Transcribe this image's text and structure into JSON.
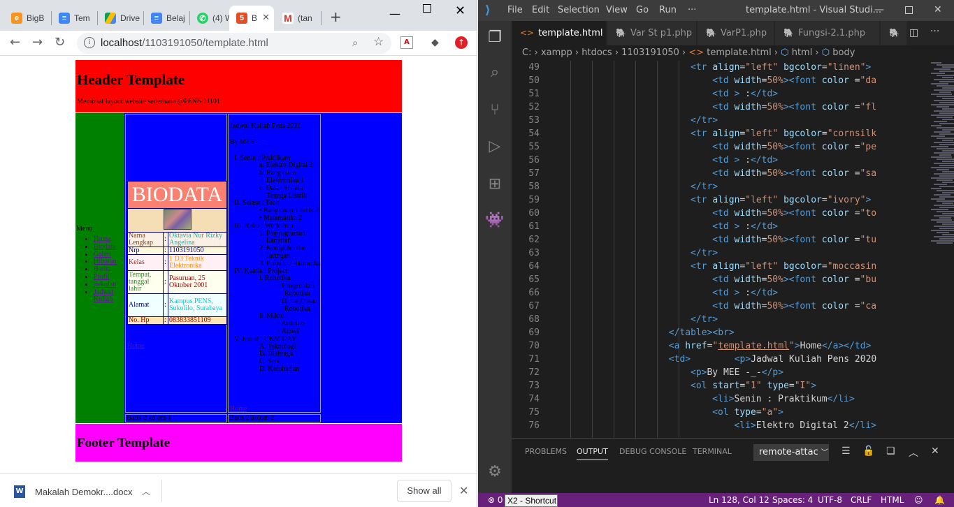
{
  "browser": {
    "tabs": [
      {
        "label": "BigB",
        "icon": "e"
      },
      {
        "label": "Tem",
        "icon": "doc"
      },
      {
        "label": "Drive",
        "icon": "drive"
      },
      {
        "label": "Belaj",
        "icon": "doc"
      },
      {
        "label": "(4) W",
        "icon": "whatsapp"
      },
      {
        "label": "B",
        "icon": "html5"
      },
      {
        "label": "(tan",
        "icon": "gmail"
      }
    ],
    "new_tab": "+",
    "url_host": "localhost",
    "url_path": "/1103191050/template.html",
    "download": {
      "filename": "Makalah Demokr....docx",
      "show_all": "Show all"
    }
  },
  "site": {
    "header_title": "Header Template",
    "header_subtitle": "Membuat layout website sederhana @PENS-1J101",
    "menu_title": "Menu",
    "menu_items": [
      "Home",
      "Biodata",
      "Galeri",
      "Hiburan",
      "Berita",
      "Profil",
      "Sekolah",
      "Jadwal Kuliah"
    ],
    "biodata": {
      "title": "BIODATA",
      "rows": [
        {
          "label": "Nama Lengkap",
          "sep": ":",
          "value": "Oktavia Nur Rizky Angelina",
          "bg": "#faf0e6",
          "lcolor": "#8b4513",
          "vcolor": "#20b2aa"
        },
        {
          "label": "Nrp",
          "sep": ":",
          "value": "1103191050",
          "bg": "#fff8dc",
          "lcolor": "#000080",
          "vcolor": "#000080"
        },
        {
          "label": "Kelas",
          "sep": ":",
          "value": "1 D3 Teknik Elektronika",
          "bg": "#fff0f5",
          "lcolor": "#b22222",
          "vcolor": "#ff8c00"
        },
        {
          "label": "Tempat, tanggal lahir",
          "sep": ":",
          "value": "Pasuruan, 25 Oktober 2001",
          "bg": "#fffff0",
          "lcolor": "#228b22",
          "vcolor": "#8b0000"
        },
        {
          "label": "Alamat",
          "sep": ":",
          "value": "Kampus PENS, Sukolilo, Surabaya",
          "bg": "#f0ffff",
          "lcolor": "#000080",
          "vcolor": "#00ced1"
        },
        {
          "label": "No. Hp",
          "sep": ":",
          "value": "083833851109",
          "bg": "#ffe4b5",
          "lcolor": "#8b0000",
          "vcolor": "#8b0000"
        }
      ],
      "home_link": "Home"
    },
    "schedule": {
      "title": "Jadwal Kuliah Pens 2020",
      "by": "By MEE -_-",
      "days": [
        {
          "num": "I.",
          "label": "Senin : Praktikum",
          "style": "a",
          "items": [
            {
              "m": "a.",
              "t": "Elektro Digital 2"
            },
            {
              "m": "b.",
              "t": "Rangkaian Elektronika 1"
            },
            {
              "m": "c.",
              "t": "Dasar Sistem Tenaga Listrik"
            }
          ]
        },
        {
          "num": "II.",
          "label": "Selasa : Teori",
          "style": "disc",
          "items": [
            {
              "m": "•",
              "t": "Rangkaian Listrik 2"
            },
            {
              "m": "•",
              "t": "Matematika 2"
            }
          ]
        },
        {
          "num": "III.",
          "label": "Rabu : Workshop",
          "style": "1",
          "items": [
            {
              "m": "1.",
              "t": "Pemrograman Lanjutan"
            },
            {
              "m": "2.",
              "t": "Komputer dan Jaringan"
            },
            {
              "m": "3.",
              "t": "Proyek Elektronika"
            }
          ]
        },
        {
          "num": "IV.",
          "label": "Kamis : Project",
          "style": "i",
          "items": [
            {
              "m": "i.",
              "t": "Robotika",
              "sub": [
                "Pengenalan Robotika",
                "Dasar-Dasar Robotika"
              ]
            },
            {
              "m": "ii.",
              "t": "Mikro",
              "sub": [
                "Arduino",
                "Atmel"
              ]
            }
          ]
        },
        {
          "num": "V.",
          "label": "Jumat : UKM DAY",
          "style": "A",
          "items": [
            {
              "m": "A.",
              "t": "Teknologi"
            },
            {
              "m": "B.",
              "t": "Olahraga"
            },
            {
              "m": "C.",
              "t": "Seni"
            },
            {
              "m": "D.",
              "t": "Keroharian"
            }
          ]
        }
      ],
      "home_link": "Home"
    },
    "row2_col1": "Baris 2 kolom 1",
    "row2_col2": "Baris 2 kolom 2",
    "footer_title": "Footer Template"
  },
  "vscode": {
    "menu": [
      "File",
      "Edit",
      "Selection",
      "View",
      "Go",
      "Run",
      "···"
    ],
    "window_title": "template.html - Visual Studi...",
    "tabs": [
      {
        "label": "template.html",
        "type": "html",
        "active": true
      },
      {
        "label": "Var St p1.php",
        "type": "php",
        "active": false
      },
      {
        "label": "VarP1.php",
        "type": "php",
        "active": false
      },
      {
        "label": "Fungsi-2.1.php",
        "type": "php",
        "active": false
      }
    ],
    "breadcrumb": [
      "C:",
      "xampp",
      "htdocs",
      "1103191050",
      "template.html",
      "html",
      "body"
    ],
    "code_lines": [
      {
        "n": "49",
        "i": 8,
        "h": "<span class=\"t\">&lt;tr</span> <span class=\"a\">align</span>=<span class=\"s\">\"left\"</span> <span class=\"a\">bgcolor</span>=<span class=\"s\">\"linen\"</span><span class=\"t\">&gt;</span>"
      },
      {
        "n": "50",
        "i": 12,
        "h": "<span class=\"t\">&lt;td</span> <span class=\"a\">width</span>=<span class=\"s\">50%</span><span class=\"t\">&gt;&lt;font</span> <span class=\"a\">color</span> =<span class=\"s\">\"da</span>"
      },
      {
        "n": "51",
        "i": 12,
        "h": "<span class=\"t\">&lt;td</span> <span class=\"t\">&gt;</span> :<span class=\"t\">&lt;/td&gt;</span>"
      },
      {
        "n": "52",
        "i": 12,
        "h": "<span class=\"t\">&lt;td</span> <span class=\"a\">width</span>=<span class=\"s\">50%</span><span class=\"t\">&gt;&lt;font</span> <span class=\"a\">color</span> =<span class=\"s\">\"fl</span>"
      },
      {
        "n": "53",
        "i": 8,
        "h": "<span class=\"t\">&lt;/tr&gt;</span>"
      },
      {
        "n": "54",
        "i": 8,
        "h": "<span class=\"t\">&lt;tr</span> <span class=\"a\">align</span>=<span class=\"s\">\"left\"</span> <span class=\"a\">bgcolor</span>=<span class=\"s\">\"cornsilk</span>"
      },
      {
        "n": "55",
        "i": 12,
        "h": "<span class=\"t\">&lt;td</span> <span class=\"a\">width</span>=<span class=\"s\">50%</span><span class=\"t\">&gt;&lt;font</span> <span class=\"a\">color</span> =<span class=\"s\">\"pe</span>"
      },
      {
        "n": "56",
        "i": 12,
        "h": "<span class=\"t\">&lt;td</span> <span class=\"t\">&gt;</span> :<span class=\"t\">&lt;/td&gt;</span>"
      },
      {
        "n": "57",
        "i": 12,
        "h": "<span class=\"t\">&lt;td</span> <span class=\"a\">width</span>=<span class=\"s\">50%</span><span class=\"t\">&gt;&lt;font</span> <span class=\"a\">color</span> =<span class=\"s\">\"sa</span>"
      },
      {
        "n": "58",
        "i": 8,
        "h": "<span class=\"t\">&lt;/tr&gt;</span>"
      },
      {
        "n": "59",
        "i": 8,
        "h": "<span class=\"t\">&lt;tr</span> <span class=\"a\">align</span>=<span class=\"s\">\"left\"</span> <span class=\"a\">bgcolor</span>=<span class=\"s\">\"ivory\"</span><span class=\"t\">&gt;</span>"
      },
      {
        "n": "60",
        "i": 12,
        "h": "<span class=\"t\">&lt;td</span> <span class=\"a\">width</span>=<span class=\"s\">50%</span><span class=\"t\">&gt;&lt;font</span> <span class=\"a\">color</span> =<span class=\"s\">\"to</span>"
      },
      {
        "n": "61",
        "i": 12,
        "h": "<span class=\"t\">&lt;td</span> <span class=\"t\">&gt;</span> :<span class=\"t\">&lt;/td&gt;</span>"
      },
      {
        "n": "62",
        "i": 12,
        "h": "<span class=\"t\">&lt;td</span> <span class=\"a\">width</span>=<span class=\"s\">50%</span><span class=\"t\">&gt;&lt;font</span> <span class=\"a\">color</span> =<span class=\"s\">\"tu</span>"
      },
      {
        "n": "63",
        "i": 8,
        "h": "<span class=\"t\">&lt;/tr&gt;</span>"
      },
      {
        "n": "64",
        "i": 8,
        "h": "<span class=\"t\">&lt;tr</span> <span class=\"a\">align</span>=<span class=\"s\">\"left\"</span> <span class=\"a\">bgcolor</span>=<span class=\"s\">\"moccasin</span>"
      },
      {
        "n": "65",
        "i": 12,
        "h": "<span class=\"t\">&lt;td</span> <span class=\"a\">width</span>=<span class=\"s\">50%</span><span class=\"t\">&gt;&lt;font</span> <span class=\"a\">color</span> =<span class=\"s\">\"bu</span>"
      },
      {
        "n": "66",
        "i": 12,
        "h": "<span class=\"t\">&lt;td</span> <span class=\"t\">&gt;</span> :<span class=\"t\">&lt;/td&gt;</span>"
      },
      {
        "n": "67",
        "i": 12,
        "h": "<span class=\"t\">&lt;td</span> <span class=\"a\">width</span>=<span class=\"s\">50%</span><span class=\"t\">&gt;&lt;font</span> <span class=\"a\">color</span> =<span class=\"s\">\"ca</span>"
      },
      {
        "n": "68",
        "i": 8,
        "h": "<span class=\"t\">&lt;/tr&gt;</span>"
      },
      {
        "n": "69",
        "i": 4,
        "h": "<span class=\"t\">&lt;/table&gt;&lt;br&gt;</span>"
      },
      {
        "n": "70",
        "i": 4,
        "h": "<span class=\"t\">&lt;a</span> <span class=\"a\">href</span>=<span class=\"s\">\"<u>template.html</u>\"</span><span class=\"t\">&gt;</span>Home<span class=\"t\">&lt;/a&gt;&lt;/td&gt;</span>"
      },
      {
        "n": "71",
        "i": 4,
        "h": "<span class=\"t\">&lt;td&gt;</span>        <span class=\"t\">&lt;p&gt;</span>Jadwal Kuliah Pens 2020"
      },
      {
        "n": "72",
        "i": 8,
        "h": "<span class=\"t\">&lt;p&gt;</span>By MEE -_-<span class=\"t\">&lt;/p&gt;</span>"
      },
      {
        "n": "73",
        "i": 8,
        "h": "<span class=\"t\">&lt;ol</span> <span class=\"a\">start</span>=<span class=\"s\">\"1\"</span> <span class=\"a\">type</span>=<span class=\"s\">\"I\"</span><span class=\"t\">&gt;</span>"
      },
      {
        "n": "74",
        "i": 12,
        "h": "<span class=\"t\">&lt;li&gt;</span>Senin : Praktikum<span class=\"t\">&lt;/li&gt;</span>"
      },
      {
        "n": "75",
        "i": 12,
        "h": "<span class=\"t\">&lt;ol</span> <span class=\"a\">type</span>=<span class=\"s\">\"a\"</span><span class=\"t\">&gt;</span>"
      },
      {
        "n": "76",
        "i": 16,
        "h": "<span class=\"t\">&lt;li&gt;</span>Elektro Digital 2<span class=\"t\">&lt;/li&gt;</span>"
      }
    ],
    "panel_tabs": [
      "PROBLEMS",
      "OUTPUT",
      "DEBUG CONSOLE",
      "TERMINAL"
    ],
    "panel_active": "OUTPUT",
    "output_channel": "remote-attac",
    "status": {
      "cursor": "Ln 128, Col 12",
      "spaces": "Spaces: 4",
      "encoding": "UTF-8",
      "eol": "CRLF",
      "language": "HTML",
      "left": "0"
    },
    "tooltip": "X2 - Shortcut"
  }
}
